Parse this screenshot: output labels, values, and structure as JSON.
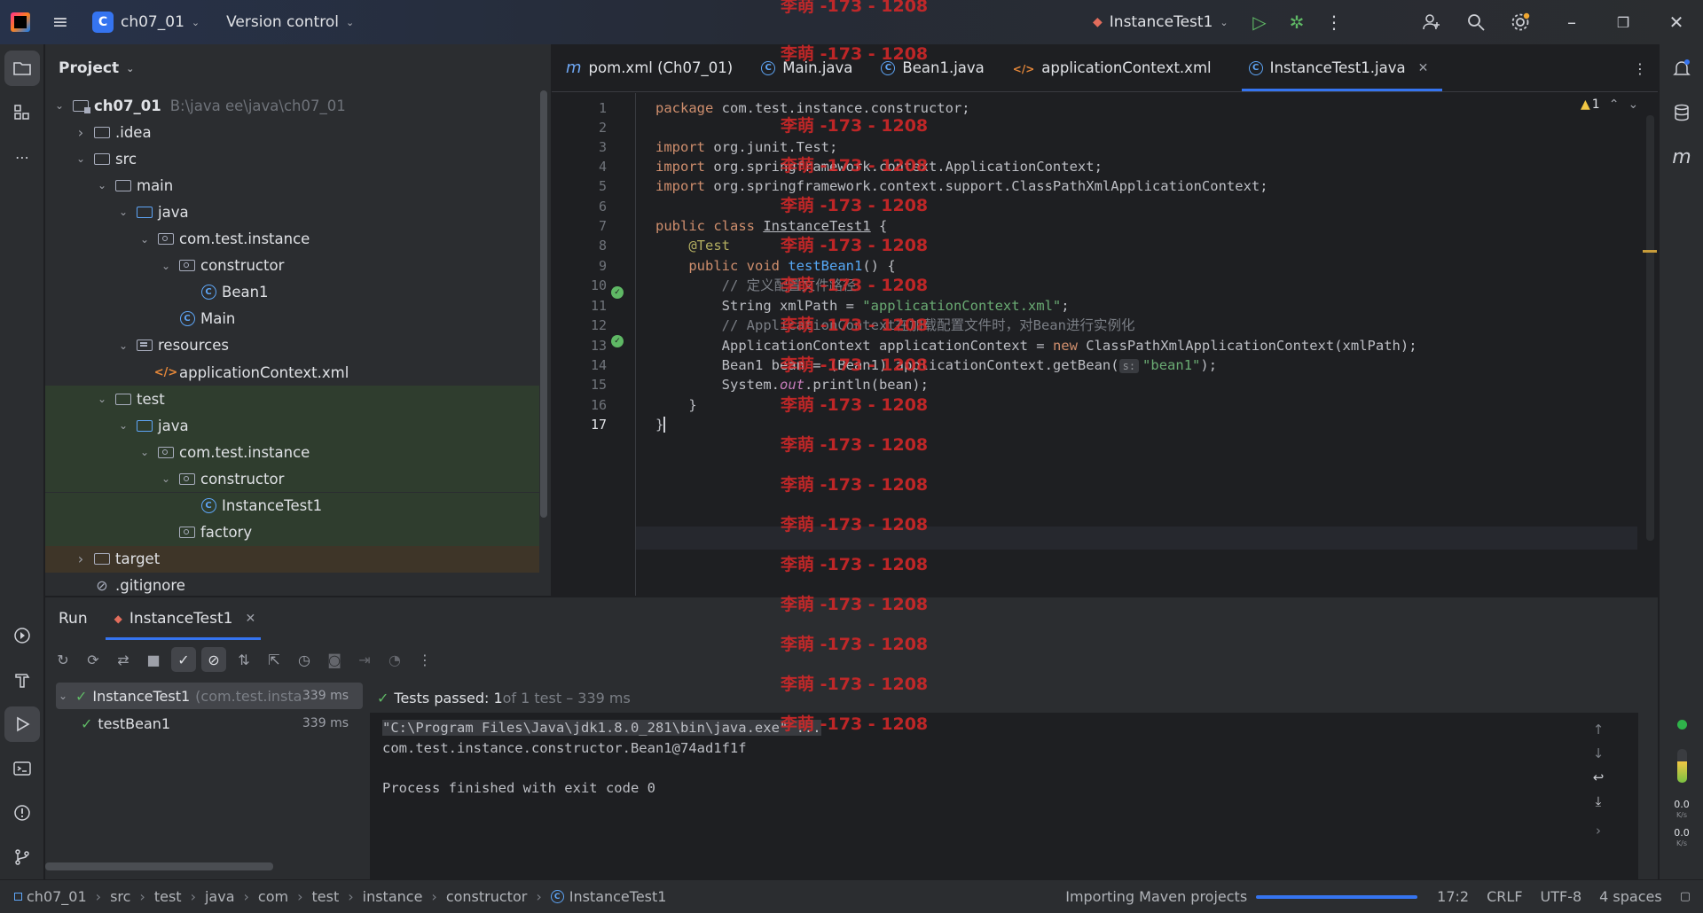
{
  "titlebar": {
    "project_letter": "C",
    "project_name": "ch07_01",
    "vcs_label": "Version control",
    "run_config": "InstanceTest1"
  },
  "project_panel": {
    "title": "Project",
    "tree": [
      {
        "label": "ch07_01",
        "path": "B:\\java ee\\java\\ch07_01",
        "icon": "module-folder",
        "indent": 0,
        "open": true
      },
      {
        "label": ".idea",
        "icon": "folder",
        "indent": 1,
        "open": false
      },
      {
        "label": "src",
        "icon": "folder",
        "indent": 1,
        "open": true
      },
      {
        "label": "main",
        "icon": "folder",
        "indent": 2,
        "open": true
      },
      {
        "label": "java",
        "icon": "source-folder",
        "indent": 3,
        "open": true
      },
      {
        "label": "com.test.instance",
        "icon": "package",
        "indent": 4,
        "open": true
      },
      {
        "label": "constructor",
        "icon": "package",
        "indent": 5,
        "open": true
      },
      {
        "label": "Bean1",
        "icon": "class",
        "indent": 6
      },
      {
        "label": "Main",
        "icon": "class",
        "indent": 5
      },
      {
        "label": "resources",
        "icon": "resources-folder",
        "indent": 3,
        "open": true
      },
      {
        "label": "applicationContext.xml",
        "icon": "xml",
        "indent": 4
      },
      {
        "label": "test",
        "icon": "folder",
        "indent": 2,
        "open": true
      },
      {
        "label": "java",
        "icon": "test-folder",
        "indent": 3,
        "open": true
      },
      {
        "label": "com.test.instance",
        "icon": "package",
        "indent": 4,
        "open": true
      },
      {
        "label": "constructor",
        "icon": "package",
        "indent": 5,
        "open": true
      },
      {
        "label": "InstanceTest1",
        "icon": "class",
        "indent": 6
      },
      {
        "label": "factory",
        "icon": "package",
        "indent": 5
      },
      {
        "label": "target",
        "icon": "folder",
        "indent": 1,
        "open": false
      },
      {
        "label": ".gitignore",
        "icon": "ignore",
        "indent": 1
      }
    ]
  },
  "editor": {
    "tabs": [
      {
        "label": "pom.xml (Ch07_01)",
        "icon": "maven-icon"
      },
      {
        "label": "Main.java",
        "icon": "class-icon"
      },
      {
        "label": "Bean1.java",
        "icon": "class-icon"
      },
      {
        "label": "applicationContext.xml",
        "icon": "xml-icon"
      },
      {
        "label": "InstanceTest1.java",
        "icon": "class-icon",
        "active": true
      }
    ],
    "warning_count": "1",
    "line_numbers": [
      "1",
      "2",
      "3",
      "4",
      "5",
      "6",
      "7",
      "8",
      "9",
      "10",
      "11",
      "12",
      "13",
      "14",
      "15",
      "16",
      "17"
    ],
    "code": {
      "l1_kw": "package",
      "l1_rest": " com.test.instance.constructor;",
      "l3_kw": "import",
      "l3_rest": " org.junit.Test;",
      "l4_kw": "import",
      "l4_rest": " org.springframework.context.ApplicationContext;",
      "l5_kw": "import",
      "l5_rest": " org.springframework.context.support.ClassPathXmlApplicationContext;",
      "l7_kw": "public class",
      "l7_name": "InstanceTest1",
      "l7_rest": " {",
      "l8_an": "    @Test",
      "l9_kw": "    public void",
      "l9_name": "testBean1",
      "l9_rest": "() {",
      "l10_cm": "        // 定义配置文件路径",
      "l11_a": "        String xmlPath = ",
      "l11_str": "\"applicationContext.xml\"",
      "l11_b": ";",
      "l12_cm": "        // ApplicationContext在加载配置文件时，对Bean进行实例化",
      "l13_a": "        ApplicationContext applicationContext = ",
      "l13_kw": "new",
      "l13_b": " ClassPathXmlApplicationContext(xmlPath);",
      "l14_a": "        Bean1 bean = (Bean1) applicationContext.getBean(",
      "l14_hint": "s:",
      "l14_str": "\"bean1\"",
      "l14_b": ");",
      "l15_a": "        System.",
      "l15_it": "out",
      "l15_b": ".println(bean);",
      "l16": "    }",
      "l17": "}"
    }
  },
  "watermark": "李萌 -173 - 1208",
  "run_panel": {
    "tab_run": "Run",
    "tab_config": "InstanceTest1",
    "tests": [
      {
        "label": "InstanceTest1",
        "detail": "(com.test.insta",
        "duration": "339 ms"
      },
      {
        "label": "testBean1",
        "duration": "339 ms"
      }
    ],
    "status_passed": "Tests passed: 1",
    "status_rest": " of 1 test – 339 ms",
    "console": [
      "\"C:\\Program Files\\Java\\jdk1.8.0_281\\bin\\java.exe\" ...",
      "com.test.instance.constructor.Bean1@74ad1f1f",
      "",
      "Process finished with exit code 0"
    ]
  },
  "net_speed": {
    "down": "0.0",
    "down_unit": "K/s",
    "up": "0.0",
    "up_unit": "K/s"
  },
  "statusbar": {
    "breadcrumbs": [
      "ch07_01",
      "src",
      "test",
      "java",
      "com",
      "test",
      "instance",
      "constructor",
      "InstanceTest1"
    ],
    "task": "Importing Maven projects",
    "position": "17:2",
    "line_sep": "CRLF",
    "encoding": "UTF-8",
    "indent": "4 spaces"
  },
  "colors": {
    "accent": "#3574f0",
    "pass": "#5fb865",
    "watermark": "#da2828"
  }
}
